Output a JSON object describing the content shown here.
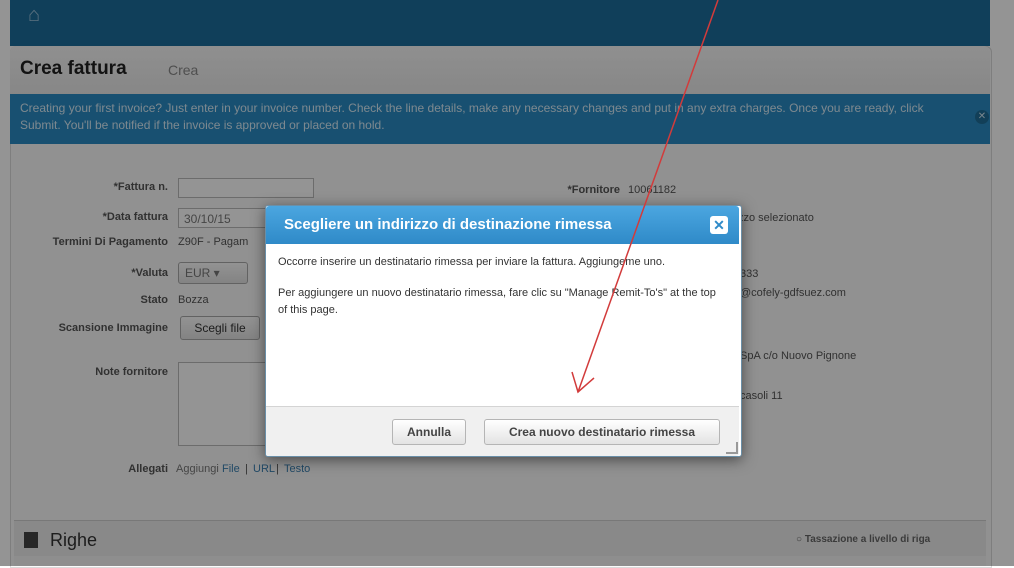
{
  "nav": {
    "home_icon": "home-icon"
  },
  "page": {
    "title": "Crea fattura",
    "subtitle": "Crea"
  },
  "info_banner": {
    "text": "Creating your first invoice? Just enter in your invoice number. Check the line details, make any necessary changes and put in any extra charges. Once you are ready, click Submit. You'll be notified if the invoice is approved or placed on hold."
  },
  "form": {
    "invoice_number_label": "*Fattura n.",
    "invoice_date_label": "*Data fattura",
    "invoice_date_value": "30/10/15",
    "payment_terms_label": "Termini Di Pagamento",
    "payment_terms_value": "Z90F - Pagam",
    "currency_label": "*Valuta",
    "currency_value": "EUR ▾",
    "status_label": "Stato",
    "status_value": "Bozza",
    "scan_label": "Scansione Immagine",
    "choose_file_label": "Scegli file",
    "supplier_notes_label": "Note fornitore",
    "attachments_label": "Allegati",
    "attachments_add": "Aggiungi",
    "attachments_file": "File",
    "attachments_url": "URL",
    "attachments_text": "Testo",
    "supplier_label": "*Fornitore",
    "supplier_value": "10061182",
    "address_selected": "zzo selezionato",
    "phone_partial": "333",
    "email_partial": "@cofely-gdfsuez.com",
    "company_partial": "SpA c/o Nuovo Pignone",
    "street_partial": "casoli 11"
  },
  "righe": {
    "title": "Righe",
    "line_tax_label": "Tassazione a livello di riga"
  },
  "dialog": {
    "title": "Scegliere un indirizzo di destinazione rimessa",
    "paragraph1": "Occorre inserire un destinatario rimessa per inviare la fattura. Aggiungeme uno.",
    "paragraph2": "Per aggiungere un nuovo destinatario rimessa, fare clic su \"Manage Remit-To's\" at the top of this page.",
    "cancel_label": "Annulla",
    "create_label": "Crea nuovo destinatario rimessa",
    "close_icon": "close-icon"
  },
  "colors": {
    "banner": "#2a8bc3",
    "dialog_header": "#3595d3",
    "arrow": "#d23b3b"
  }
}
